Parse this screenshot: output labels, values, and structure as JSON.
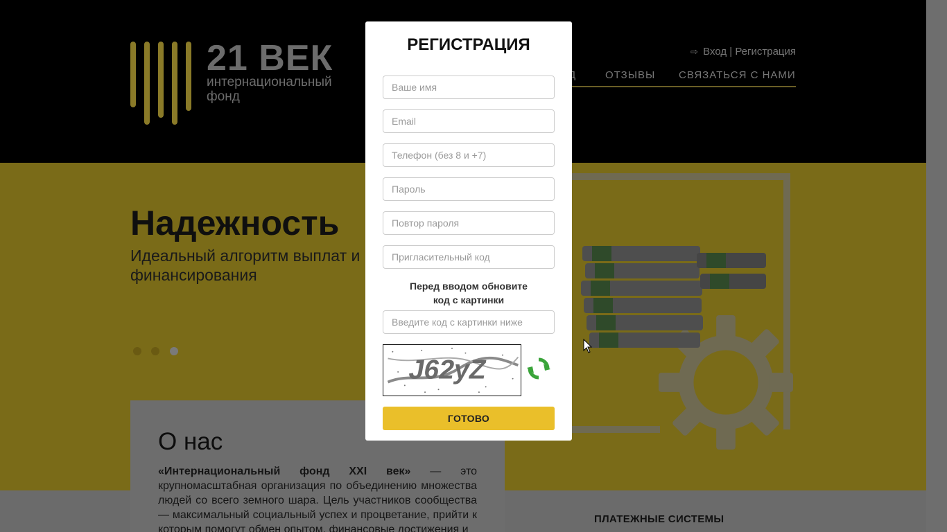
{
  "logo": {
    "big": "21 ВЕК",
    "sub": "интернациональный фонд"
  },
  "auth": {
    "icon": "sign-in-icon",
    "text": "Вход | Регистрация"
  },
  "nav": {
    "items": [
      "Д",
      "ОТЗЫВЫ",
      "СВЯЗАТЬСЯ С НАМИ"
    ]
  },
  "hero": {
    "title": "Надежность",
    "subtitle": "Идеальный алгоритм выплат и финансирования",
    "slides": 3,
    "active_slide": 3
  },
  "about": {
    "title": "О нас",
    "lead": "«Интернациональный фонд XXI век»",
    "text": " — это крупномасштабная организация по объединению множества людей со всего земного шара. Цель участников сообщества — максимальный социальный успех и процветание, прийти к которым помогут обмен опытом, финансовые достижения и"
  },
  "payments": {
    "title": "ПЛАТЕЖНЫЕ СИСТЕМЫ"
  },
  "modal": {
    "title": "РЕГИСТРАЦИЯ",
    "fields": {
      "name": "Ваше имя",
      "email": "Email",
      "phone": "Телефон (без 8 и +7)",
      "password": "Пароль",
      "password_repeat": "Повтор пароля",
      "invite": "Пригласительный код"
    },
    "captcha_note_1": "Перед вводом обновите",
    "captcha_note_2": "код с картинки",
    "captcha_placeholder": "Введите код с картинки ниже",
    "captcha_text": "J62yZ",
    "refresh_icon": "refresh-icon",
    "submit": "ГОТОВО"
  },
  "colors": {
    "accent": "#eabf2a",
    "header": "#000000",
    "hero_bg": "#f5d62e",
    "overlay": "rgba(0,0,0,0.5)"
  }
}
